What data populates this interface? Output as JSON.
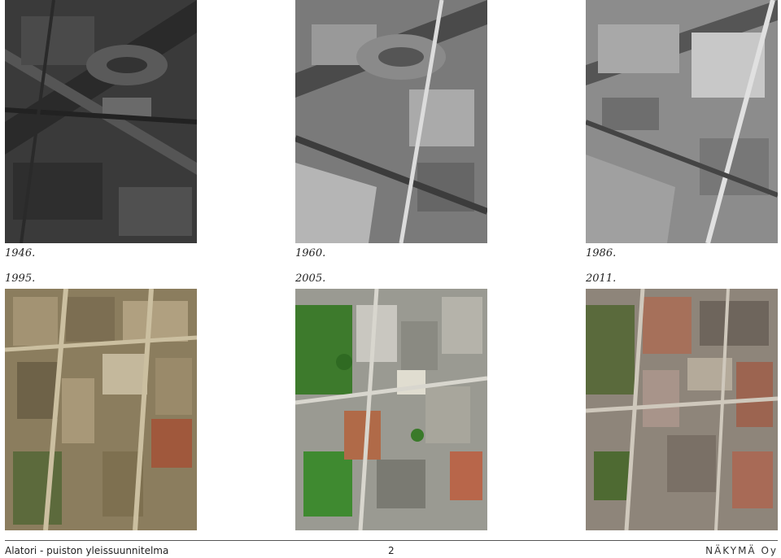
{
  "photos": [
    {
      "year": "1946.",
      "kind": "bw-dark"
    },
    {
      "year": "1960.",
      "kind": "bw-mid"
    },
    {
      "year": "1986.",
      "kind": "bw-light"
    },
    {
      "year": "1995.",
      "kind": "color-warm"
    },
    {
      "year": "2005.",
      "kind": "color-green"
    },
    {
      "year": "2011.",
      "kind": "color-neutral"
    }
  ],
  "footer": {
    "title": "Alatori - puiston yleissuunnitelma",
    "page": "2",
    "company": "NÄKYMÄ Oy"
  }
}
